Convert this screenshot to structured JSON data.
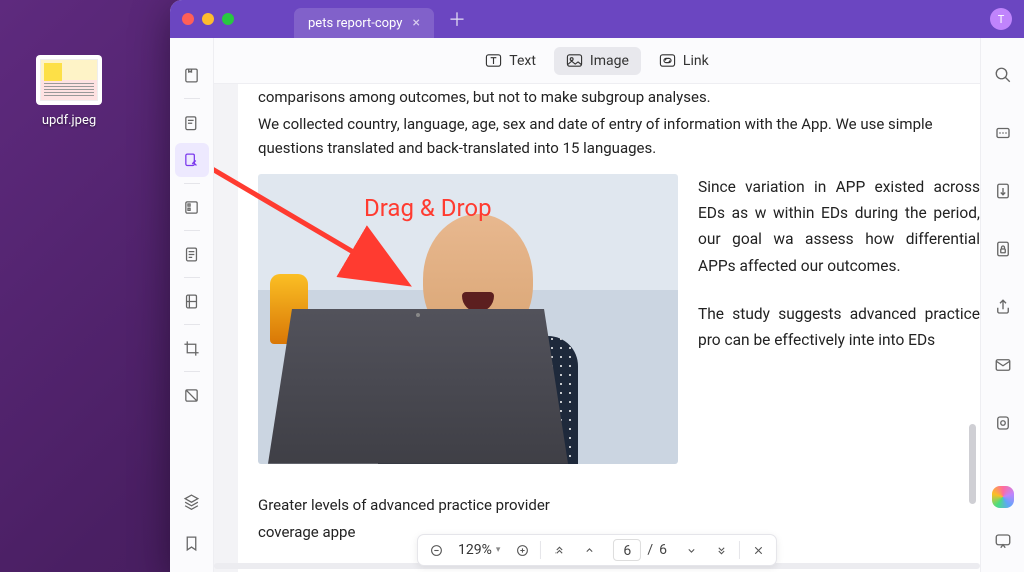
{
  "desktop": {
    "file_name": "updf.jpeg"
  },
  "titlebar": {
    "tab_name": "pets report-copy",
    "avatar_letter": "T"
  },
  "toolbar": {
    "text_label": "Text",
    "image_label": "Image",
    "link_label": "Link"
  },
  "document": {
    "line1": "comparisons among outcomes, but not to make subgroup analyses.",
    "line2": "We collected country, language, age, sex and date of entry of information with the App. We use simple questions translated and back-translated into 15 languages.",
    "right1": "Since variation in APP existed across EDs as w within EDs during the period, our goal wa assess how differential APPs affected our outcomes.",
    "right2": "The study suggests advanced practice pro can be effectively inte into EDs",
    "line3a": "Greater levels of advanced practice provider",
    "line3b": "coverage appe"
  },
  "overlay": {
    "drag_label": "Drag & Drop"
  },
  "bottom_bar": {
    "zoom": "129%",
    "current_page": "6",
    "total_pages": "6",
    "separator": "/"
  }
}
